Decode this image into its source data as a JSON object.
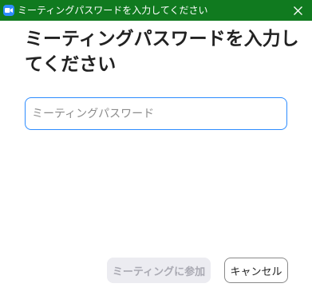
{
  "window": {
    "title": "ミーティングパスワードを入力してください",
    "app_icon": "zoom-camera-icon",
    "close_icon": "close-icon"
  },
  "dialog": {
    "heading": "ミーティングパスワードを入力してください",
    "password_field": {
      "value": "",
      "placeholder": "ミーティングパスワード"
    },
    "join_button": {
      "label": "ミーティングに参加",
      "enabled": false
    },
    "cancel_button": {
      "label": "キャンセル"
    }
  },
  "colors": {
    "titlebar": "#107a1f",
    "accent": "#2d8cff",
    "disabled_button_bg": "#ececf1",
    "disabled_button_text": "#aaaab3"
  }
}
